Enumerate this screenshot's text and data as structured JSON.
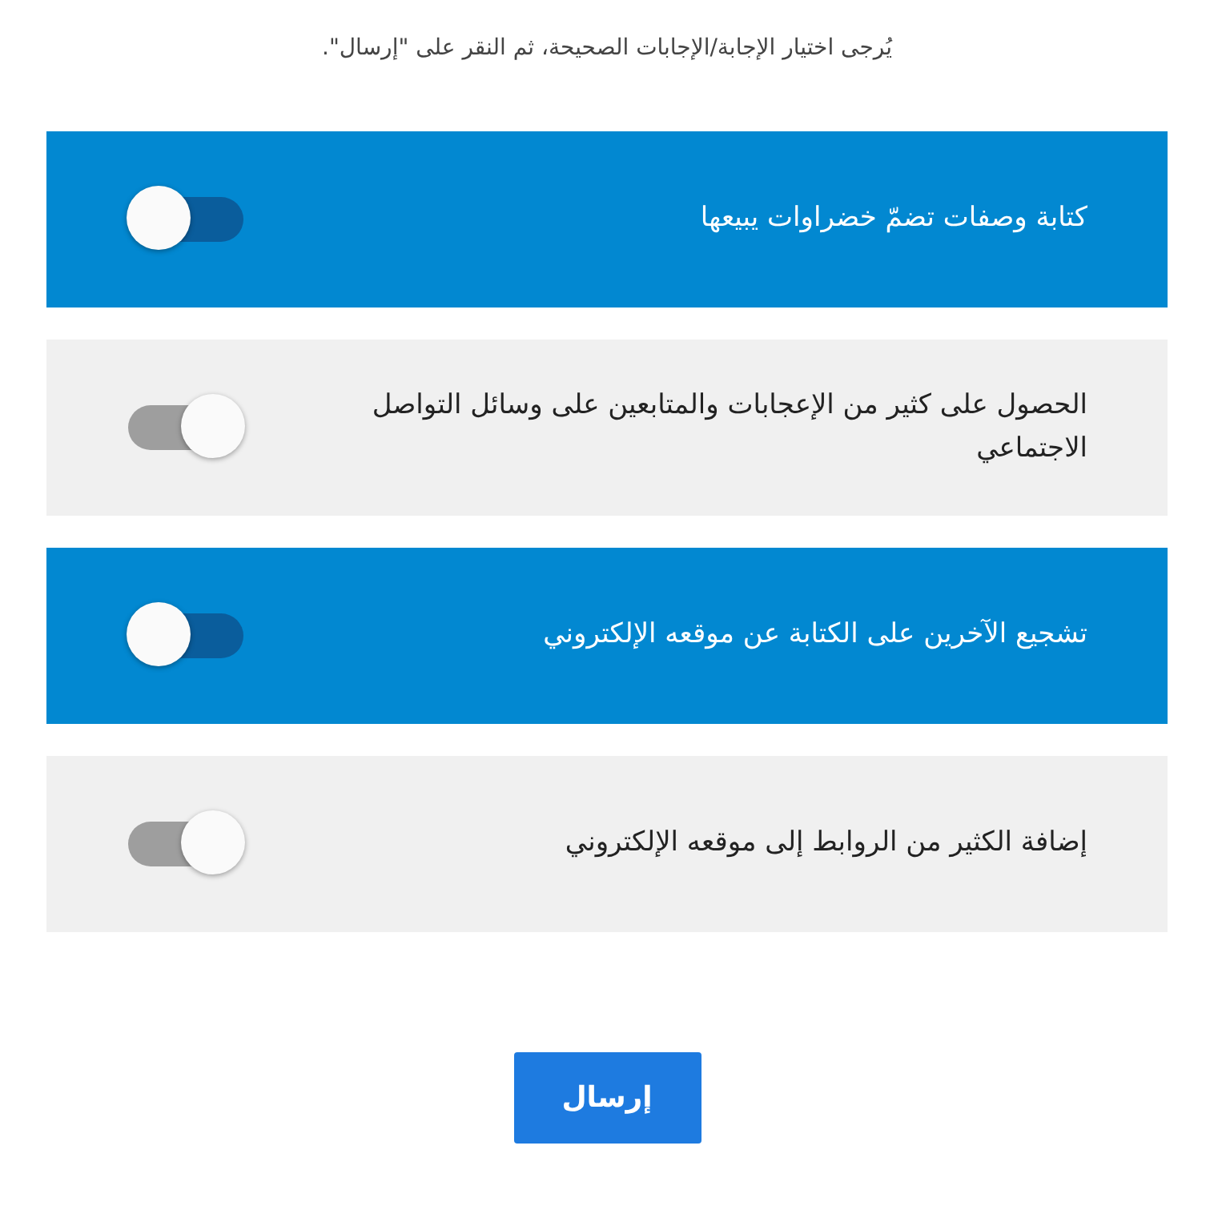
{
  "instruction": "يُرجى اختيار الإجابة/الإجابات الصحيحة، ثم النقر على \"إرسال\".",
  "options": [
    {
      "label": "كتابة وصفات تضمّ خضراوات يبيعها",
      "selected": true
    },
    {
      "label": "الحصول على كثير من الإعجابات والمتابعين على وسائل التواصل الاجتماعي",
      "selected": false
    },
    {
      "label": "تشجيع الآخرين على الكتابة عن موقعه الإلكتروني",
      "selected": true
    },
    {
      "label": "إضافة الكثير من الروابط إلى موقعه الإلكتروني",
      "selected": false
    }
  ],
  "submit": "إرسال"
}
